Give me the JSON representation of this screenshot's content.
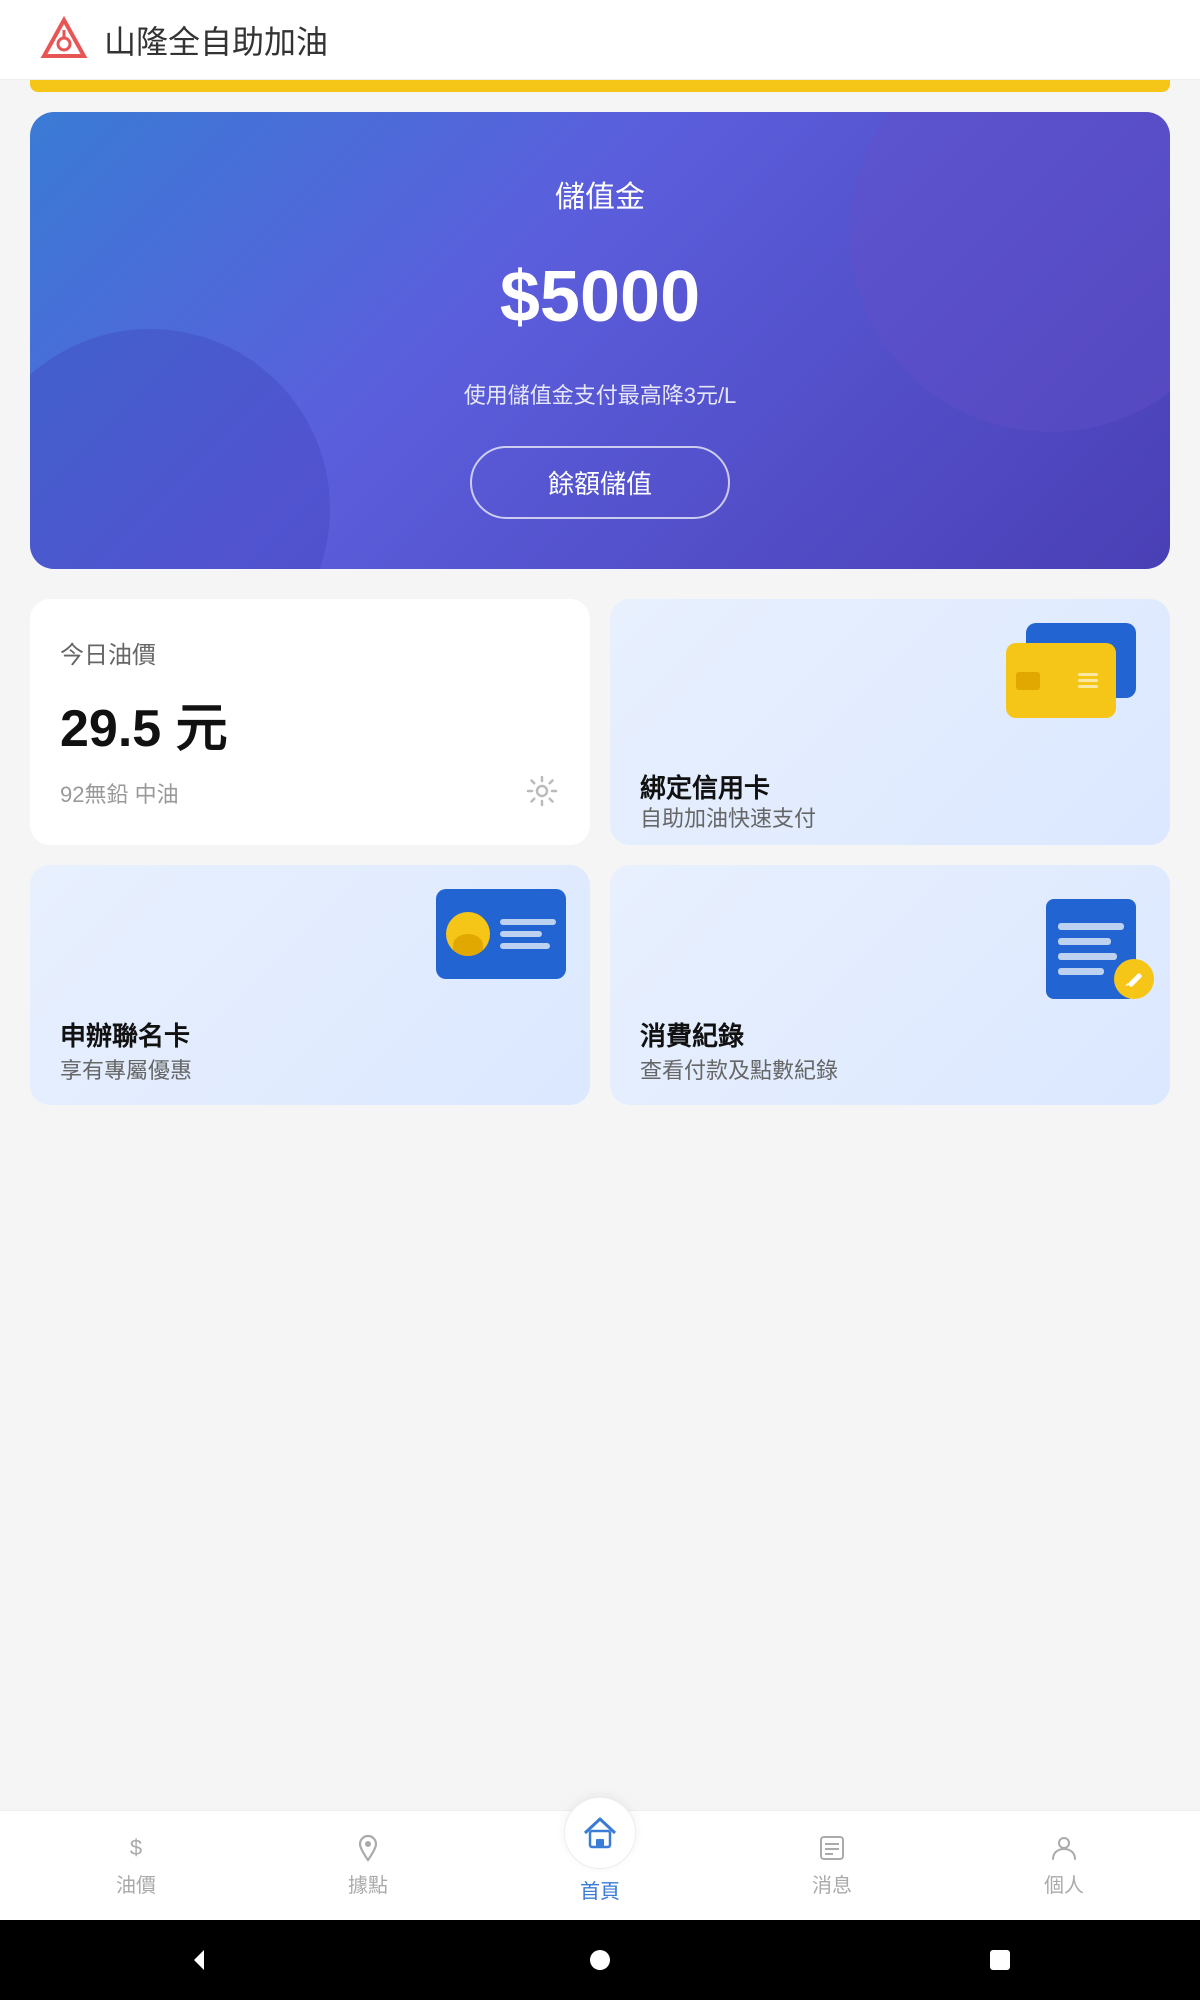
{
  "header": {
    "title": "山隆全自助加油",
    "logo_alt": "山隆 logo"
  },
  "balance_card": {
    "label": "儲值金",
    "amount": "$5000",
    "tip": "使用儲值金支付最高降3元/L",
    "recharge_btn": "餘額儲值"
  },
  "oil_price": {
    "section_label": "今日油價",
    "price": "29.5 元",
    "description": "92無鉛 中油"
  },
  "credit_card": {
    "title": "綁定信用卡",
    "subtitle": "自助加油快速支付"
  },
  "membership": {
    "title": "申辦聯名卡",
    "subtitle": "享有專屬優惠"
  },
  "transaction": {
    "title": "消費紀錄",
    "subtitle": "查看付款及點數紀錄"
  },
  "bottom_nav": {
    "items": [
      {
        "label": "油價",
        "icon": "dollar"
      },
      {
        "label": "據點",
        "icon": "location"
      },
      {
        "label": "首頁",
        "icon": "home",
        "active": true
      },
      {
        "label": "消息",
        "icon": "news"
      },
      {
        "label": "個人",
        "icon": "person"
      }
    ]
  },
  "system_bar": {
    "back": "◀",
    "home": "●",
    "recent": "■"
  }
}
